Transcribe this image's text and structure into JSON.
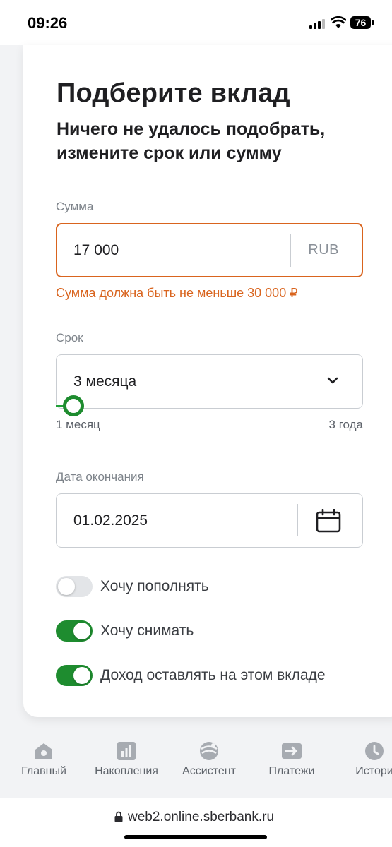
{
  "status_bar": {
    "time": "09:26",
    "battery": "76"
  },
  "page": {
    "title": "Подберите вклад",
    "subtitle": "Ничего не удалось подобрать, измените срок или сумму"
  },
  "amount": {
    "label": "Сумма",
    "value": "17 000",
    "currency": "RUB",
    "error": "Сумма должна быть не меньше 30 000 ₽"
  },
  "term": {
    "label": "Срок",
    "value": "3 месяца",
    "range_min": "1 месяц",
    "range_max": "3 года"
  },
  "end_date": {
    "label": "Дата окончания",
    "value": "01.02.2025"
  },
  "toggles": [
    {
      "label": "Хочу пополнять",
      "on": false
    },
    {
      "label": "Хочу снимать",
      "on": true
    },
    {
      "label": "Доход оставлять на этом вкладе",
      "on": true
    }
  ],
  "bottom_nav": [
    {
      "label": "Главный",
      "icon": "home-icon"
    },
    {
      "label": "Накопления",
      "icon": "savings-chart-icon"
    },
    {
      "label": "Ассистент",
      "icon": "assistant-icon"
    },
    {
      "label": "Платежи",
      "icon": "payments-icon"
    },
    {
      "label": "Истори",
      "icon": "history-icon"
    }
  ],
  "browser": {
    "url": "web2.online.sberbank.ru"
  },
  "colors": {
    "accent_green": "#1e8c2f",
    "error_orange": "#d9641e"
  }
}
